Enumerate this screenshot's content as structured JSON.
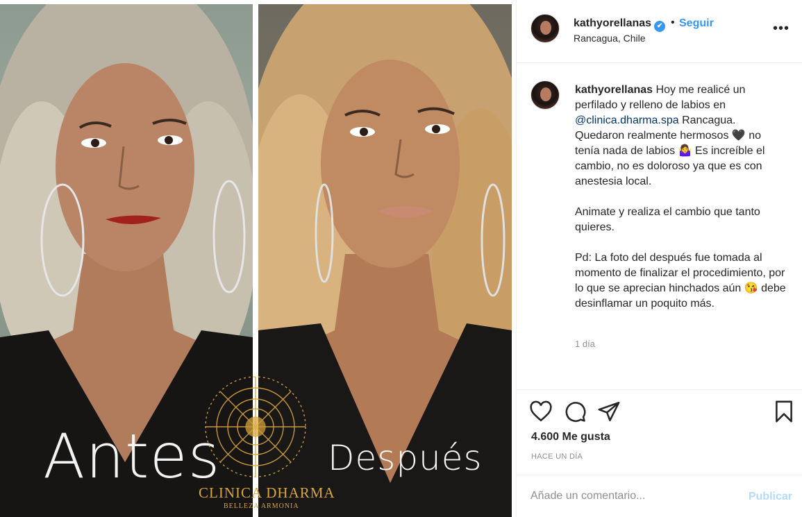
{
  "post": {
    "username": "kathyorellanas",
    "verified_mark": "✔",
    "separator": "•",
    "follow_label": "Seguir",
    "location": "Rancagua, Chile",
    "more_label": "•••"
  },
  "caption": {
    "username": "kathyorellanas",
    "text_1a": " Hoy me realicé un perfilado y relleno de labios en ",
    "mention": "@clinica.dharma.spa",
    "text_1b": " Rancagua. Quedaron realmente hermosos 🖤 no tenía nada de labios 🤷‍♀️ Es increíble el cambio, no es doloroso ya que es con anestesia local.",
    "text_2": "Animate y realiza el cambio que tanto quieres.",
    "text_3": "Pd: La foto del después fue tomada al momento de finalizar el procedimiento, por lo que se aprecian hinchados aún 😘 debe desinflamar un poquito más.",
    "time": "1 día"
  },
  "media": {
    "label_before": "Antes",
    "label_after": "Después",
    "brand": "CLINICA DHARMA",
    "brand_sub": "BELLEZA ARMONIA"
  },
  "actions": {
    "icons": [
      "heart-icon",
      "comment-icon",
      "share-icon",
      "bookmark-icon"
    ],
    "likes": "4.600 Me gusta",
    "posted": "HACE UN DÍA"
  },
  "comment_box": {
    "placeholder": "Añade un comentario...",
    "publish_label": "Publicar"
  },
  "colors": {
    "accent": "#3897f0",
    "brand_gold": "#d9a63a",
    "publish_disabled": "#b3dbff"
  }
}
